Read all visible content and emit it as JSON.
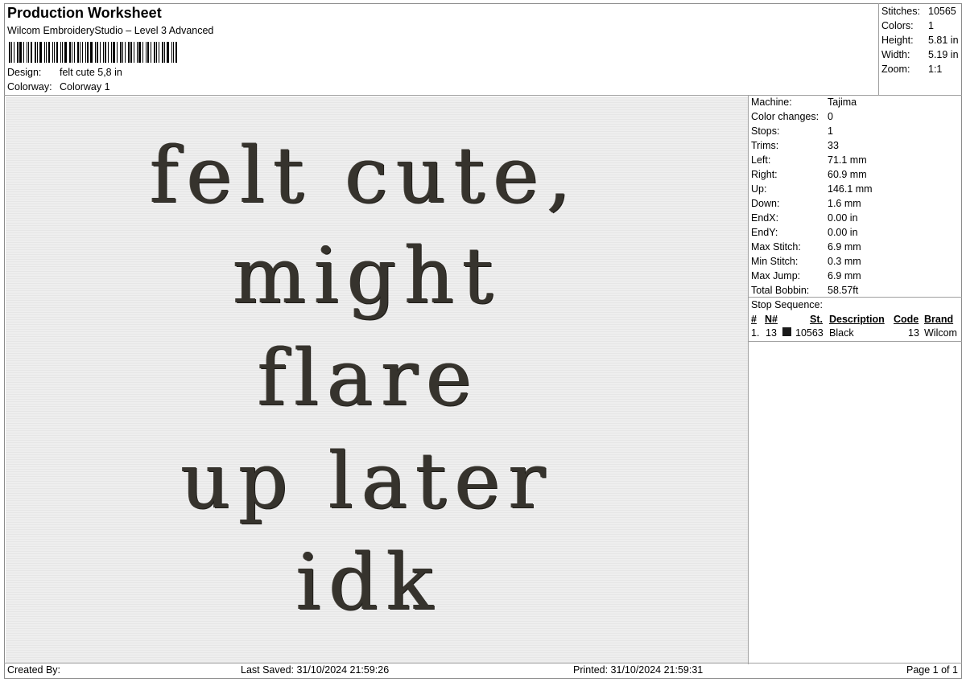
{
  "header": {
    "title": "Production Worksheet",
    "software": "Wilcom EmbroideryStudio – Level 3 Advanced",
    "design_label": "Design:",
    "design_value": "felt cute 5,8 in",
    "colorway_label": "Colorway:",
    "colorway_value": "Colorway 1"
  },
  "summary": [
    {
      "label": "Stitches:",
      "value": "10565"
    },
    {
      "label": "Colors:",
      "value": "1"
    },
    {
      "label": "Height:",
      "value": "5.81 in"
    },
    {
      "label": "Width:",
      "value": "5.19 in"
    },
    {
      "label": "Zoom:",
      "value": "1:1"
    }
  ],
  "design_text_lines": [
    "felt cute,",
    "might",
    "flare",
    "up later",
    "idk"
  ],
  "thread_color": "#36332d",
  "machine_info": [
    {
      "label": "Machine:",
      "value": "Tajima"
    },
    {
      "label": "Color changes:",
      "value": "0"
    },
    {
      "label": "Stops:",
      "value": "1"
    },
    {
      "label": "Trims:",
      "value": "33"
    },
    {
      "label": "Left:",
      "value": "71.1 mm"
    },
    {
      "label": "Right:",
      "value": "60.9 mm"
    },
    {
      "label": "Up:",
      "value": "146.1 mm"
    },
    {
      "label": "Down:",
      "value": "1.6 mm"
    },
    {
      "label": "EndX:",
      "value": "0.00 in"
    },
    {
      "label": "EndY:",
      "value": "0.00 in"
    },
    {
      "label": "Max Stitch:",
      "value": "6.9 mm"
    },
    {
      "label": "Min Stitch:",
      "value": "0.3 mm"
    },
    {
      "label": "Max Jump:",
      "value": "6.9 mm"
    },
    {
      "label": "Total Bobbin:",
      "value": "58.57ft"
    }
  ],
  "stop_sequence": {
    "title": "Stop Sequence:",
    "columns": [
      "#",
      "N#",
      "St.",
      "Description",
      "Code",
      "Brand"
    ],
    "rows": [
      {
        "num": "1.",
        "n": "13",
        "swatch": "#1a1a1a",
        "st": "10563",
        "description": "Black",
        "code": "13",
        "brand": "Wilcom"
      }
    ]
  },
  "footer": {
    "created_by": "Created By:",
    "last_saved": "Last Saved: 31/10/2024 21:59:26",
    "printed": "Printed: 31/10/2024 21:59:31",
    "page": "Page 1 of 1"
  }
}
